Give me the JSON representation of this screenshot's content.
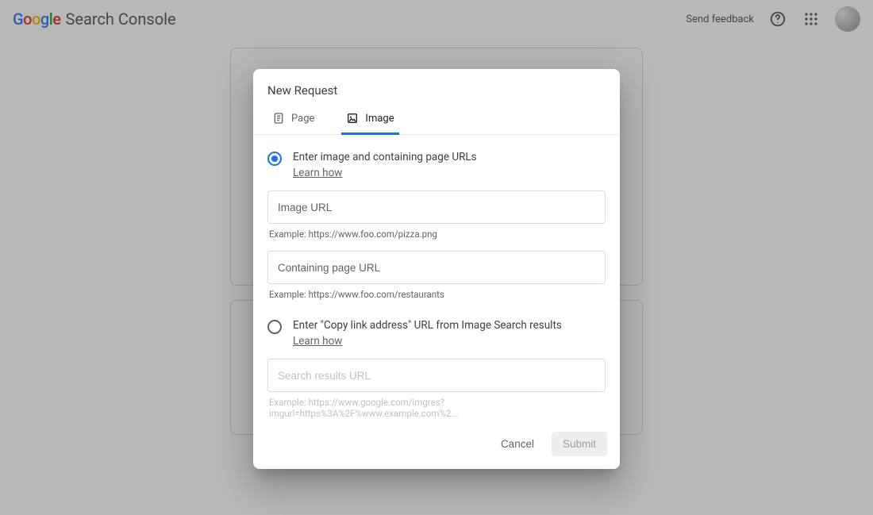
{
  "header": {
    "product": "Search Console",
    "feedback": "Send feedback"
  },
  "dialog": {
    "title": "New Request",
    "tabs": {
      "page": "Page",
      "image": "Image"
    },
    "option1": {
      "label": "Enter image and containing page URLs",
      "learn": "Learn how",
      "image_url_placeholder": "Image URL",
      "image_url_helper": "Example: https://www.foo.com/pizza.png",
      "page_url_placeholder": "Containing page URL",
      "page_url_helper": "Example: https://www.foo.com/restaurants"
    },
    "option2": {
      "label": "Enter \"Copy link address\" URL from Image Search results",
      "learn": "Learn how",
      "search_url_placeholder": "Search results URL",
      "search_url_helper": "Example: https://www.google.com/imgres?imgurl=https%3A%2F%www.example.com%2..."
    },
    "actions": {
      "cancel": "Cancel",
      "submit": "Submit"
    }
  }
}
